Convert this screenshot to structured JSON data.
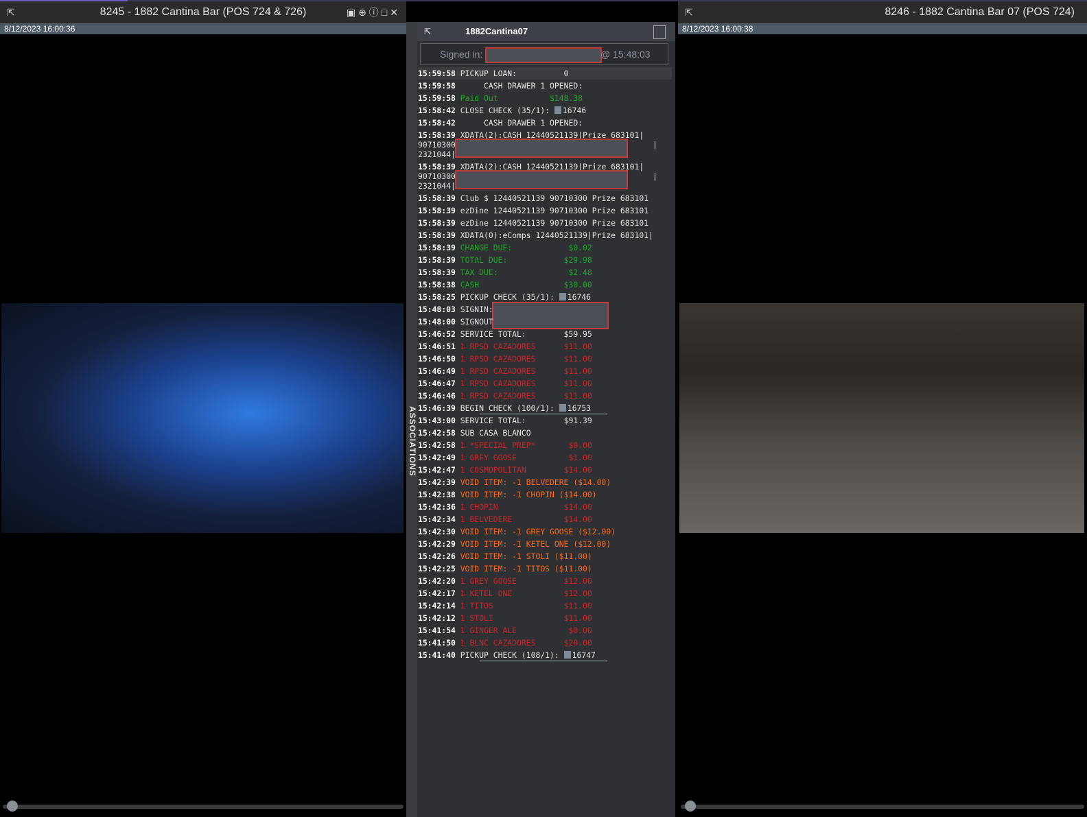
{
  "left_camera": {
    "title": "8245 - 1882 Cantina Bar (POS 724 & 726)",
    "timestamp": "8/12/2023 16:00:36"
  },
  "right_camera": {
    "title": "8246 - 1882 Cantina Bar 07 (POS 724)",
    "timestamp": "8/12/2023 16:00:38"
  },
  "panel": {
    "title": "1882Cantina07",
    "associations_label": "ASSOCIATIONS",
    "signed_in_label": "Signed in:",
    "signed_in_time": "@ 15:48:03"
  },
  "log": [
    {
      "t": "15:59:58",
      "text": "PICKUP LOAN:          0",
      "style": "normal"
    },
    {
      "t": "15:59:58",
      "text": "     CASH DRAWER 1 OPENED:",
      "style": "normal"
    },
    {
      "t": "15:59:58",
      "text": "Paid Out           $148.38",
      "style": "green"
    },
    {
      "t": "15:58:42",
      "text": "CLOSE CHECK (35/1): ",
      "check": "16746",
      "style": "normal"
    },
    {
      "t": "15:58:42",
      "text": "     CASH DRAWER 1 OPENED:",
      "style": "normal"
    },
    {
      "t": "15:58:39",
      "text": "XDATA(2):CASH 12440521139|Prize 683101|",
      "cont1": "90710300",
      "cont2": "2321044|",
      "style": "tall"
    },
    {
      "t": "15:58:39",
      "text": "XDATA(2):CASH 12440521139|Prize 683101|",
      "cont1": "90710300",
      "cont2": "2321044|K",
      "style": "tall"
    },
    {
      "t": "15:58:39",
      "text": "Club $ 12440521139 90710300 Prize 683101",
      "style": "normal"
    },
    {
      "t": "15:58:39",
      "text": "ezDine 12440521139 90710300 Prize 683101",
      "style": "normal"
    },
    {
      "t": "15:58:39",
      "text": "ezDine 12440521139 90710300 Prize 683101",
      "style": "normal"
    },
    {
      "t": "15:58:39",
      "text": "XDATA(0):eComps 12440521139|Prize 683101|",
      "style": "normal"
    },
    {
      "t": "15:58:39",
      "text": "CHANGE DUE:            $0.02",
      "style": "green"
    },
    {
      "t": "15:58:39",
      "text": "TOTAL DUE:            $29.98",
      "style": "green"
    },
    {
      "t": "15:58:39",
      "text": "TAX DUE:               $2.48",
      "style": "green"
    },
    {
      "t": "15:58:38",
      "text": "CASH                  $30.00",
      "style": "green"
    },
    {
      "t": "15:58:25",
      "text": "PICKUP CHECK (35/1): ",
      "check": "16746",
      "style": "normal"
    },
    {
      "t": "15:48:03",
      "text": "SIGNIN:",
      "style": "normal",
      "redact": true
    },
    {
      "t": "15:48:00",
      "text": "SIGNOUT",
      "style": "normal"
    },
    {
      "t": "15:46:52",
      "text": "SERVICE TOTAL:        $59.95",
      "style": "normal"
    },
    {
      "t": "15:46:51",
      "text": "1 RPSD CAZADORES      $11.00",
      "style": "red"
    },
    {
      "t": "15:46:50",
      "text": "1 RPSD CAZADORES      $11.00",
      "style": "red"
    },
    {
      "t": "15:46:49",
      "text": "1 RPSD CAZADORES      $11.00",
      "style": "red"
    },
    {
      "t": "15:46:47",
      "text": "1 RPSD CAZADORES      $11.00",
      "style": "red"
    },
    {
      "t": "15:46:46",
      "text": "1 RPSD CAZADORES      $11.00",
      "style": "red"
    },
    {
      "t": "15:46:39",
      "text": "BEGIN CHECK (100/1): ",
      "check": "16753",
      "style": "normal",
      "underline": true
    },
    {
      "t": "15:43:00",
      "text": "SERVICE TOTAL:        $91.39",
      "style": "normal"
    },
    {
      "t": "15:42:58",
      "text": "SUB CASA BLANCO",
      "style": "normal"
    },
    {
      "t": "15:42:58",
      "text": "1 *SPECIAL PREP*       $0.00",
      "style": "red"
    },
    {
      "t": "15:42:49",
      "text": "1 GREY GOOSE           $1.00",
      "style": "red"
    },
    {
      "t": "15:42:47",
      "text": "1 COSMOPOLITAN        $14.00",
      "style": "red"
    },
    {
      "t": "15:42:39",
      "text": "VOID ITEM: -1 BELVEDERE ($14.00)",
      "style": "orange"
    },
    {
      "t": "15:42:38",
      "text": "VOID ITEM: -1 CHOPIN ($14.00)",
      "style": "orange"
    },
    {
      "t": "15:42:36",
      "text": "1 CHOPIN              $14.00",
      "style": "red"
    },
    {
      "t": "15:42:34",
      "text": "1 BELVEDERE           $14.00",
      "style": "red"
    },
    {
      "t": "15:42:30",
      "text": "VOID ITEM: -1 GREY GOOSE ($12.00)",
      "style": "orange"
    },
    {
      "t": "15:42:29",
      "text": "VOID ITEM: -1 KETEL ONE ($12.00)",
      "style": "orange"
    },
    {
      "t": "15:42:26",
      "text": "VOID ITEM: -1 STOLI ($11.00)",
      "style": "orange"
    },
    {
      "t": "15:42:25",
      "text": "VOID ITEM: -1 TITOS ($11.00)",
      "style": "orange"
    },
    {
      "t": "15:42:20",
      "text": "1 GREY GOOSE          $12.00",
      "style": "red"
    },
    {
      "t": "15:42:17",
      "text": "1 KETEL ONE           $12.00",
      "style": "red"
    },
    {
      "t": "15:42:14",
      "text": "1 TITOS               $11.00",
      "style": "red"
    },
    {
      "t": "15:42:12",
      "text": "1 STOLI               $11.00",
      "style": "red"
    },
    {
      "t": "15:41:54",
      "text": "1 GINGER ALE           $0.00",
      "style": "red"
    },
    {
      "t": "15:41:50",
      "text": "1 BLNC CAZADORES      $20.00",
      "style": "red"
    },
    {
      "t": "15:41:40",
      "text": "PICKUP CHECK (108/1): ",
      "check": "16747",
      "style": "normal",
      "underline": true
    }
  ]
}
